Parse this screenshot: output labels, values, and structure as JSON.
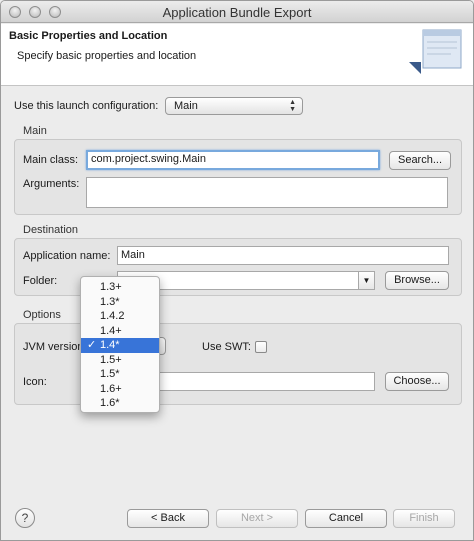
{
  "window": {
    "title": "Application Bundle Export"
  },
  "header": {
    "title": "Basic Properties and Location",
    "description": "Specify basic properties and location"
  },
  "launch_config": {
    "label": "Use this launch configuration:",
    "value": "Main"
  },
  "main_group": {
    "title": "Main",
    "main_class_label": "Main class:",
    "main_class_value": "com.project.swing.Main",
    "search_button": "Search...",
    "arguments_label": "Arguments:",
    "arguments_value": ""
  },
  "destination_group": {
    "title": "Destination",
    "app_name_label": "Application name:",
    "app_name_value": "Main",
    "folder_label": "Folder:",
    "folder_value": "",
    "browse_button": "Browse..."
  },
  "options_group": {
    "title": "Options",
    "jvm_label": "JVM version",
    "use_swt_label": "Use SWT:",
    "use_swt_checked": false,
    "icon_label": "Icon:",
    "icon_value": "",
    "choose_button": "Choose..."
  },
  "jvm_dropdown": {
    "items": [
      "1.3+",
      "1.3*",
      "1.4.2",
      "1.4+",
      "1.4*",
      "1.5+",
      "1.5*",
      "1.6+",
      "1.6*"
    ],
    "selected_index": 4,
    "check_glyph": "✓"
  },
  "footer": {
    "help_glyph": "?",
    "back_button": "< Back",
    "next_button": "Next >",
    "cancel_button": "Cancel",
    "finish_button": "Finish"
  },
  "colors": {
    "selection": "#3874d8",
    "focus_ring": "#78a9dd"
  }
}
